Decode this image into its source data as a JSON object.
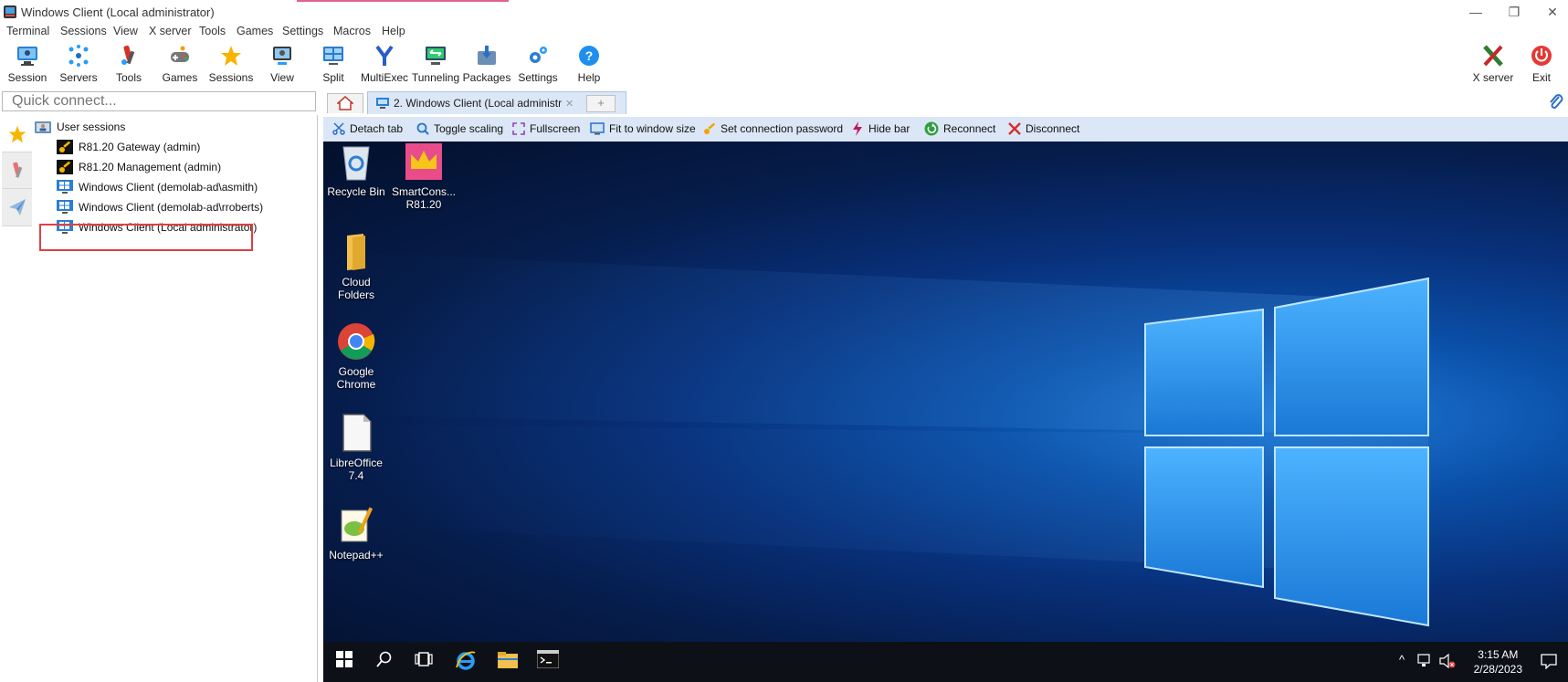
{
  "window": {
    "title": "Windows Client (Local administrator)"
  },
  "menu": [
    "Terminal",
    "Sessions",
    "View",
    "X server",
    "Tools",
    "Games",
    "Settings",
    "Macros",
    "Help"
  ],
  "toolbar": {
    "buttons": [
      "Session",
      "Servers",
      "Tools",
      "Games",
      "Sessions",
      "View",
      "Split",
      "MultiExec",
      "Tunneling",
      "Packages",
      "Settings",
      "Help"
    ],
    "right_buttons": [
      "X server",
      "Exit"
    ]
  },
  "quick_connect": {
    "placeholder": "Quick connect..."
  },
  "tabs": {
    "active_label": "2. Windows Client (Local administrat"
  },
  "sessions": {
    "root": "User sessions",
    "items": [
      "R81.20 Gateway (admin)",
      "R81.20 Management (admin)",
      "Windows Client (demolab-ad\\asmith)",
      "Windows Client (demolab-ad\\rroberts)",
      "Windows Client (Local administrator)"
    ]
  },
  "remote_toolbar": [
    "Detach tab",
    "Toggle scaling",
    "Fullscreen",
    "Fit to window size",
    "Set connection password",
    "Hide bar",
    "Reconnect",
    "Disconnect"
  ],
  "desktop_icons": [
    {
      "line1": "Recycle Bin",
      "line2": ""
    },
    {
      "line1": "SmartCons...",
      "line2": "R81.20"
    },
    {
      "line1": "Cloud",
      "line2": "Folders"
    },
    {
      "line1": "Google",
      "line2": "Chrome"
    },
    {
      "line1": "LibreOffice",
      "line2": "7.4"
    },
    {
      "line1": "Notepad++",
      "line2": ""
    }
  ],
  "taskbar": {
    "time": "3:15 AM",
    "date": "2/28/2023"
  },
  "colors": {
    "remote_toolbar_bg": "#dbe7f6",
    "highlight": "#e04040",
    "accent_line": "#e2618a"
  }
}
